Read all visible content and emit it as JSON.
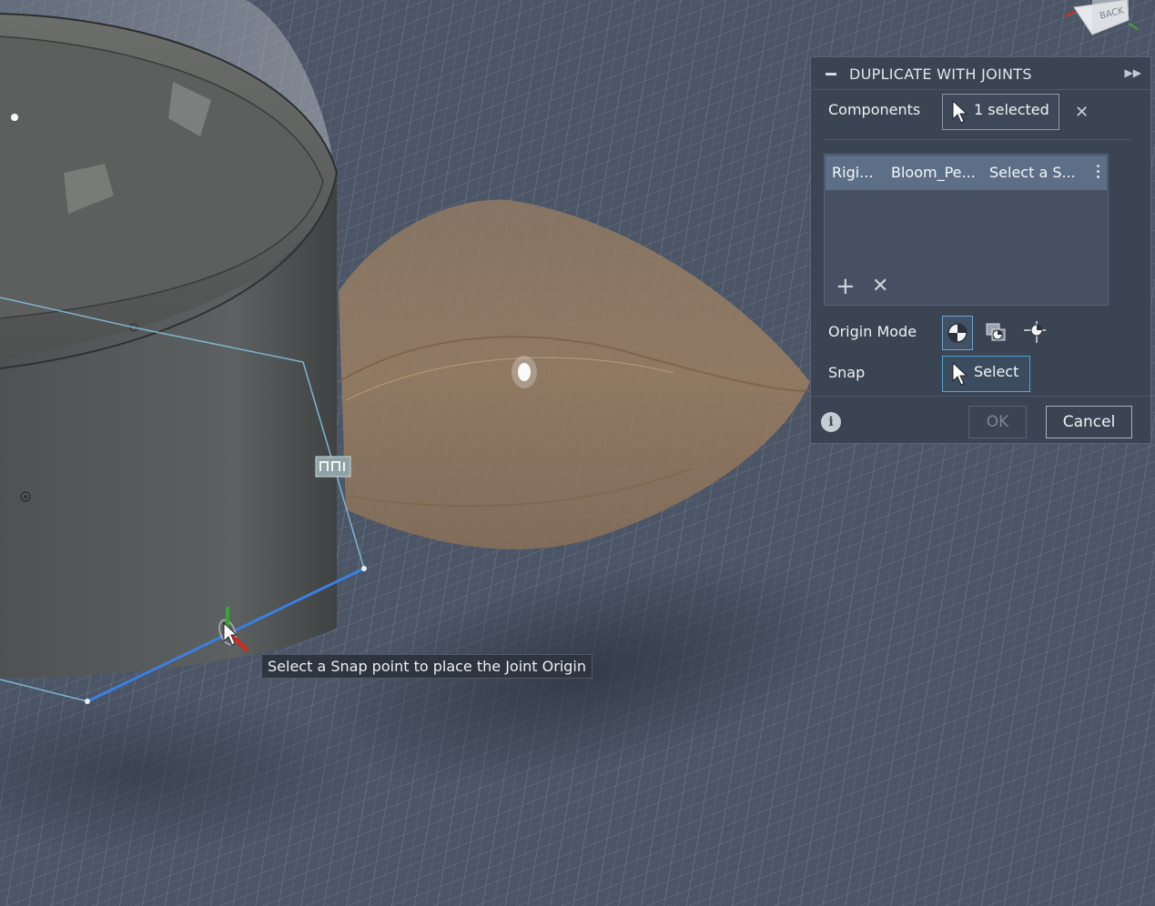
{
  "dialog": {
    "title": "DUPLICATE WITH JOINTS",
    "components_label": "Components",
    "components_value": "1 selected",
    "joint_row": {
      "type": "Rigi...",
      "component": "Bloom_Pe...",
      "snap": "Select a S..."
    },
    "origin_mode_label": "Origin Mode",
    "snap_label": "Snap",
    "snap_value": "Select",
    "ok_label": "OK",
    "cancel_label": "Cancel"
  },
  "viewcube": {
    "face_label": "BACK"
  },
  "tooltip": "Select a Snap point to place the Joint Origin",
  "colors": {
    "background": "#4b5566",
    "grid": "#8f99a8",
    "body": "#56595c",
    "petal": "#b09070",
    "selection_line": "#3a7fe6",
    "dialog_bg": "#3b4453",
    "highlight_border": "#4fa6d8"
  }
}
